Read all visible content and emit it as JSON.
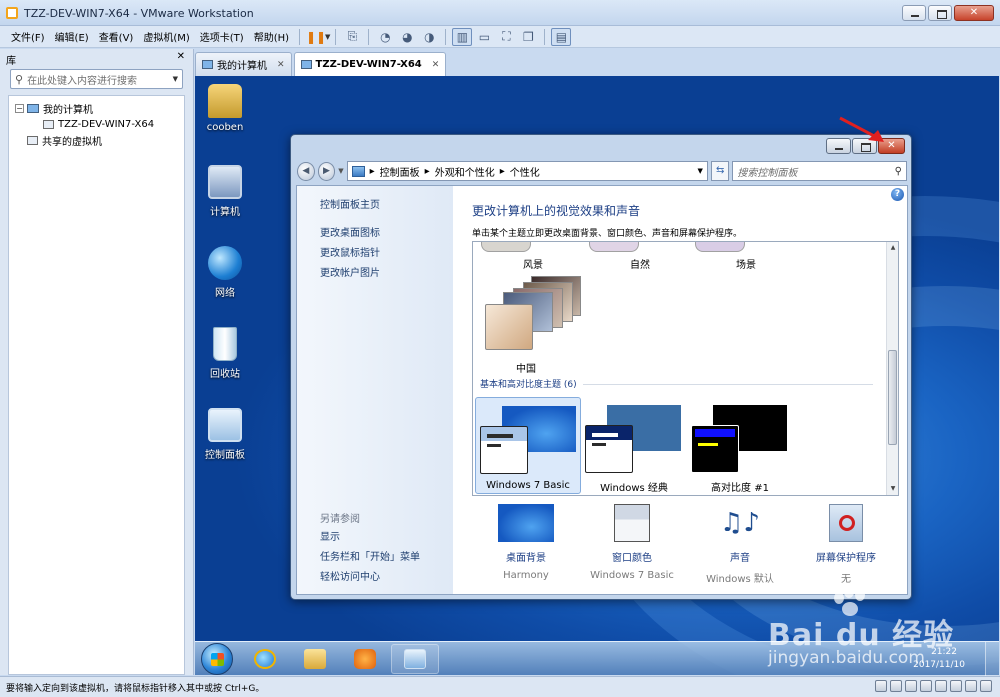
{
  "window": {
    "title": "TZZ-DEV-WIN7-X64 - VMware Workstation"
  },
  "menubar": {
    "items": [
      "文件(F)",
      "编辑(E)",
      "查看(V)",
      "虚拟机(M)",
      "选项卡(T)",
      "帮助(H)"
    ]
  },
  "toolbar": {
    "icons": [
      "pause-icon",
      "send-keys-icon",
      "snapshot-icon",
      "revert-snapshot-icon",
      "snapshot-manager-icon",
      "view-normal-icon",
      "view-console-icon",
      "view-fullscreen-icon",
      "view-unity-icon",
      "thumbnail-icon"
    ]
  },
  "library": {
    "title": "库",
    "search_placeholder": "在此处键入内容进行搜索",
    "tree": {
      "root": "我的计算机",
      "child": "TZZ-DEV-WIN7-X64",
      "shared": "共享的虚拟机"
    }
  },
  "tabs": [
    {
      "label": "我的计算机"
    },
    {
      "label": "TZZ-DEV-WIN7-X64"
    }
  ],
  "desktop_icons": [
    {
      "label": "cooben"
    },
    {
      "label": "计算机"
    },
    {
      "label": "网络"
    },
    {
      "label": "回收站"
    },
    {
      "label": "控制面板"
    }
  ],
  "personalize": {
    "breadcrumb": [
      "控制面板",
      "外观和个性化",
      "个性化"
    ],
    "search_placeholder": "搜索控制面板",
    "left": {
      "home": "控制面板主页",
      "links": [
        "更改桌面图标",
        "更改鼠标指针",
        "更改帐户图片"
      ],
      "see_also": "另请参阅",
      "bottom_links": [
        "显示",
        "任务栏和「开始」菜单",
        "轻松访问中心"
      ]
    },
    "heading": "更改计算机上的视觉效果和声音",
    "subheading": "单击某个主题立即更改桌面背景、窗口颜色、声音和屏幕保护程序。",
    "top_themes": [
      "风景",
      "自然",
      "场景"
    ],
    "china_theme": "中国",
    "basic_group": "基本和高对比度主题 (6)",
    "basic_themes": [
      "Windows 7 Basic",
      "Windows 经典",
      "高对比度 #1"
    ],
    "bottom_items": [
      {
        "label": "桌面背景",
        "value": "Harmony"
      },
      {
        "label": "窗口颜色",
        "value": "Windows 7 Basic"
      },
      {
        "label": "声音",
        "value": "Windows 默认"
      },
      {
        "label": "屏幕保护程序",
        "value": "无"
      }
    ]
  },
  "taskbar": {
    "time": "21:22",
    "date": "2017/11/10"
  },
  "watermark": {
    "brand": "Bai du 经验",
    "url": "jingyan.baidu.com"
  },
  "statusbar": {
    "text": "要将输入定向到该虚拟机，请将鼠标指针移入其中或按 Ctrl+G。"
  },
  "colors": {
    "accent_link": "#1d3f85",
    "close_red": "#c7432b",
    "desktop_blue": "#1a64c3"
  }
}
